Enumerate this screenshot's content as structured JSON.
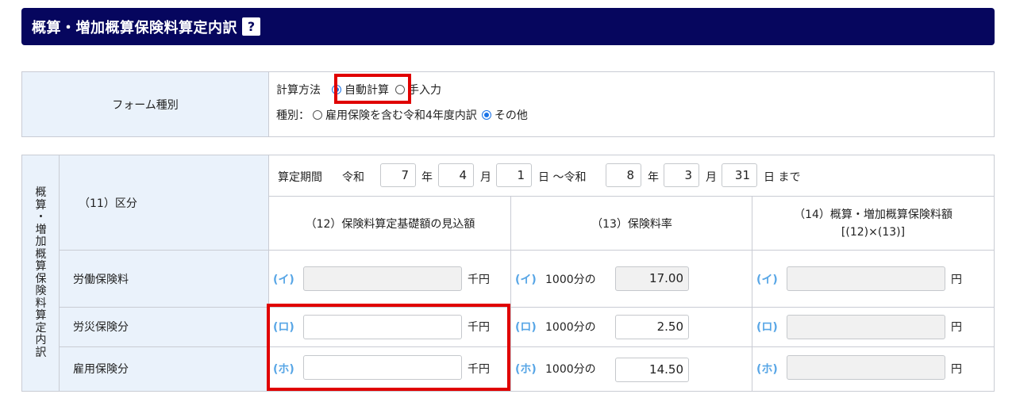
{
  "header": {
    "title": "概算・増加概算保険料算定内訳",
    "help": "?"
  },
  "form_type": {
    "label": "フォーム種別",
    "calc_method_label": "計算方法",
    "calc_auto": "自動計算",
    "calc_manual": "手入力",
    "type_label": "種別：",
    "type_option1": "雇用保険を含む令和4年度内訳",
    "type_option2": "その他"
  },
  "breakdown": {
    "side_label": [
      "概",
      "算",
      "・",
      "増",
      "加",
      "概",
      "算",
      "保",
      "険",
      "料",
      "算",
      "定",
      "内",
      "訳"
    ],
    "section_label": "（11）区分",
    "period": {
      "label": "算定期間",
      "era1": "令和",
      "from_year": "7",
      "year_unit": "年",
      "from_month": "4",
      "month_unit": "月",
      "from_day": "1",
      "day_unit_to": "日 ～令和",
      "to_year": "8",
      "to_month": "3",
      "to_day": "31",
      "end_text": "日 まで"
    },
    "col12": "（12）保険料算定基礎額の見込額",
    "col13": "（13）保険料率",
    "col14_line1": "（14）概算・増加概算保険料額",
    "col14_line2": "[(12)×(13)]",
    "unit_thousand": "千円",
    "unit_yen": "円",
    "rate_prefix": "1000分の",
    "rows": [
      {
        "label": "労働保険料",
        "kana": "(イ)",
        "rate": "17.00"
      },
      {
        "label": "労災保険分",
        "kana": "(ロ)",
        "rate": "2.50"
      },
      {
        "label": "雇用保険分",
        "kana": "(ホ)",
        "rate": "14.50"
      }
    ]
  }
}
